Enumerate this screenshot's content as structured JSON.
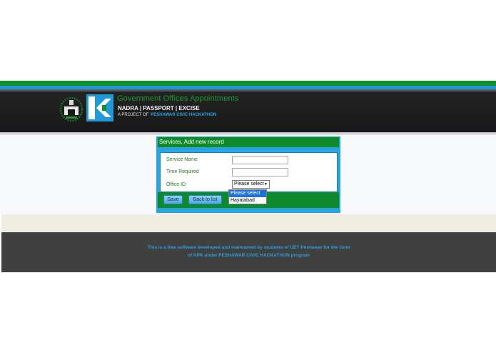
{
  "header": {
    "title": "Government Offices Appointments",
    "subtitle": "NADRA | PASSPORT | EXCISE",
    "project_prefix": "A PROJECT OF",
    "project_name": "PESHAWAR CIVIC HACKATHON"
  },
  "form": {
    "title": "Services, Add new record",
    "fields": {
      "service_name": {
        "label": "Service Name",
        "value": ""
      },
      "time_required": {
        "label": "Time Required",
        "value": ""
      },
      "office_id": {
        "label": "Office ID",
        "selected": "Please select"
      }
    },
    "dropdown_options": [
      "Please select",
      "Hayatabad"
    ],
    "save_label": "Save",
    "back_label": "Back to list"
  },
  "footer": {
    "line1": "This is a free software developed and maintained by students of UET Peshawar for the Govt",
    "line2": "of KPK under PESHAWAR CIVIC HACKATHON program"
  },
  "colors": {
    "brand_green": "#0d8f2a",
    "brand_blue": "#1f9ad8",
    "footer_text": "#2a9ee0"
  }
}
